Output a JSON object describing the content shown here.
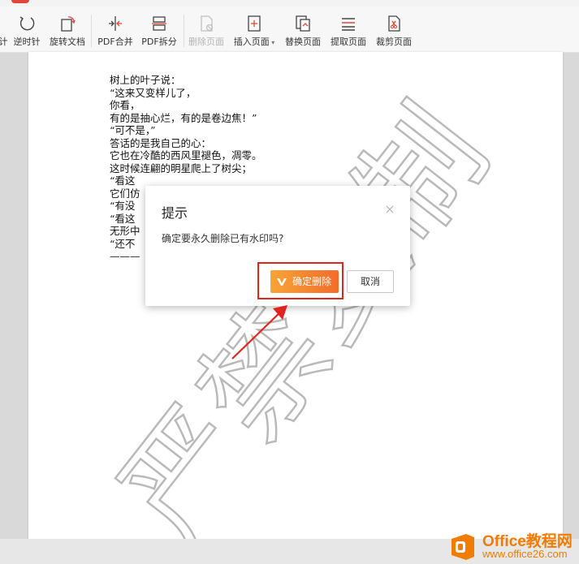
{
  "toolbar": {
    "items": [
      {
        "label": "计"
      },
      {
        "label": "逆时针"
      },
      {
        "label": "旋转文档"
      },
      {
        "label": "PDF合并"
      },
      {
        "label": "PDF拆分"
      },
      {
        "label": "删除页面"
      },
      {
        "label": "插入页面"
      },
      {
        "label": "替换页面"
      },
      {
        "label": "提取页面"
      },
      {
        "label": "裁剪页面"
      }
    ]
  },
  "document": {
    "lines": [
      "树上的叶子说：",
      "“这来又变样儿了，",
      "你看，",
      "有的是抽心烂，有的是卷边焦！”",
      "“可不是，”",
      "答话的是我自己的心：",
      "它也在冷酷的西风里褪色，凋零。",
      "这时候连翩的明星爬上了树尖；",
      "“看这",
      "它们仿",
      "“有没",
      "“看这",
      "无形中",
      "“还不",
      "———"
    ],
    "watermark": "严禁复制"
  },
  "dialog": {
    "title": "提示",
    "message": "确定要永久删除已有水印吗?",
    "confirm_label": "确定删除",
    "cancel_label": "取消"
  },
  "logo": {
    "name": "Office教程网",
    "url": "www.office26.com"
  },
  "colors": {
    "accent_start": "#f9a437",
    "accent_end": "#f36c2b",
    "highlight": "#e0251f",
    "logo": "#f07c00"
  }
}
